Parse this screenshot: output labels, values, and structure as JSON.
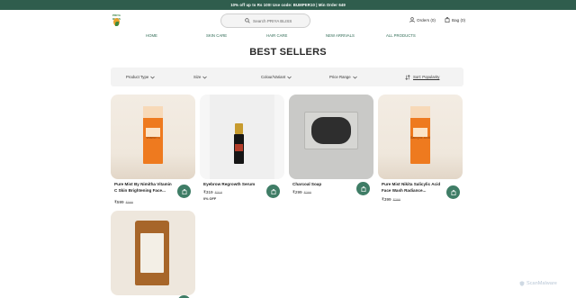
{
  "announcement": "10% off up to Rs 100! Use code: BUMPER10 | Min Order 649",
  "brand": {
    "logo_text": "PRIYA BLISS"
  },
  "search": {
    "placeholder": "Search PRIYA BLISS"
  },
  "header": {
    "orders_label": "Orders (0)",
    "bag_label": "Bag (0)"
  },
  "nav": [
    "HOME",
    "SKIN CARE",
    "HAIR CARE",
    "NEW ARRIVALS",
    "ALL PRODUCTS"
  ],
  "page_title": "BEST SELLERS",
  "filters": {
    "product_type": "Product Type",
    "size": "Size",
    "color": "Colour/Variant",
    "price": "Price Range",
    "sort": "Sort: Popularity"
  },
  "products": [
    {
      "name": "Pure Mist By Nimitha Vitamin C Skin Brightening Face...",
      "price": "₹599",
      "mrp": "₹599",
      "box_text": "Vitamin C",
      "accent": "#ee7a1f"
    },
    {
      "name": "Eyebrow Regrowth Serum",
      "price": "₹319",
      "mrp": "₹319",
      "offer": "0% OFF",
      "accent": "#151515"
    },
    {
      "name": "Charcoal Soap",
      "price": "₹299",
      "mrp": "₹299",
      "accent": "#2e2e2e"
    },
    {
      "name": "Pure Mist Nikita Salicylic Acid Face Wash Radiance...",
      "price": "₹399",
      "mrp": "₹399",
      "box_text": "Salicylic Acid",
      "accent": "#ee7a1f"
    },
    {
      "name": "",
      "price": "",
      "mrp": "",
      "accent": "#a7662a"
    }
  ],
  "colors": {
    "announce_bg": "#2f5d4d",
    "nav_text": "#2f6b55",
    "cart_button": "#3f7d66"
  },
  "watermark": "ScanMalware"
}
